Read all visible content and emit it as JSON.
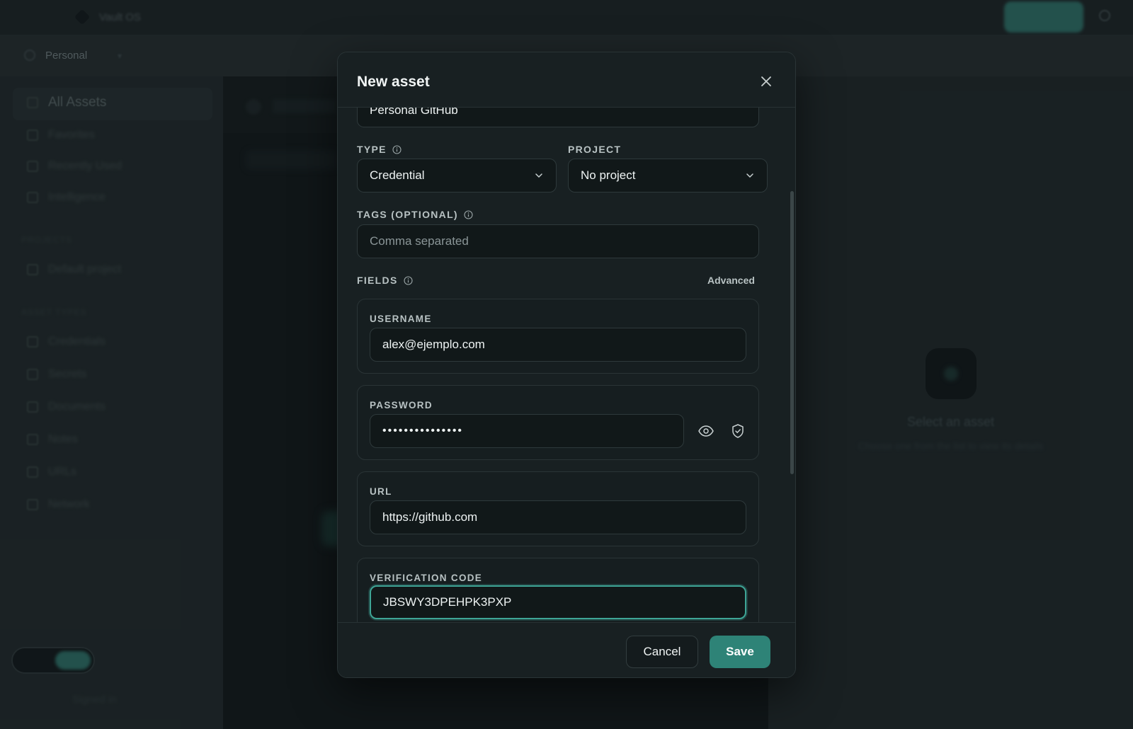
{
  "app": {
    "name": "Vault OS"
  },
  "workspace": {
    "name": "Personal"
  },
  "sidebar": {
    "items": [
      {
        "label": "All Assets",
        "icon": "grid-icon"
      },
      {
        "label": "Favorites",
        "icon": "star-icon"
      },
      {
        "label": "Recently Used",
        "icon": "clock-icon"
      },
      {
        "label": "Intelligence",
        "icon": "sparkle-icon"
      }
    ],
    "section_projects": "PROJECTS",
    "projects": [
      {
        "label": "Default project",
        "icon": "folder-icon"
      }
    ],
    "section_types": "ASSET TYPES",
    "types": [
      {
        "label": "Credentials",
        "icon": "key-icon"
      },
      {
        "label": "Secrets",
        "icon": "lock-icon"
      },
      {
        "label": "Documents",
        "icon": "document-icon"
      },
      {
        "label": "Notes",
        "icon": "note-icon"
      },
      {
        "label": "URLs",
        "icon": "link-icon"
      },
      {
        "label": "Network",
        "icon": "network-icon"
      }
    ],
    "footer": "Signed in"
  },
  "right_panel": {
    "title": "Select an asset",
    "subtitle": "Choose one from the list to view its details"
  },
  "modal": {
    "title": "New asset",
    "name_value": "Personal GitHub",
    "type": {
      "label": "TYPE",
      "value": "Credential"
    },
    "project": {
      "label": "PROJECT",
      "value": "No project"
    },
    "tags": {
      "label": "TAGS (OPTIONAL)",
      "placeholder": "Comma separated"
    },
    "fields": {
      "label": "FIELDS",
      "advanced_label": "Advanced",
      "username": {
        "label": "USERNAME",
        "value": "alex@ejemplo.com"
      },
      "password": {
        "label": "PASSWORD",
        "value": "•••••••••••••••"
      },
      "url": {
        "label": "URL",
        "value": "https://github.com"
      },
      "verification_code": {
        "label": "VERIFICATION CODE",
        "value": "JBSWY3DPEHPK3PXP"
      }
    },
    "cancel_label": "Cancel",
    "save_label": "Save"
  },
  "colors": {
    "accent": "#2e8377",
    "modal_bg": "#182022",
    "focus_ring": "#3ea596"
  }
}
